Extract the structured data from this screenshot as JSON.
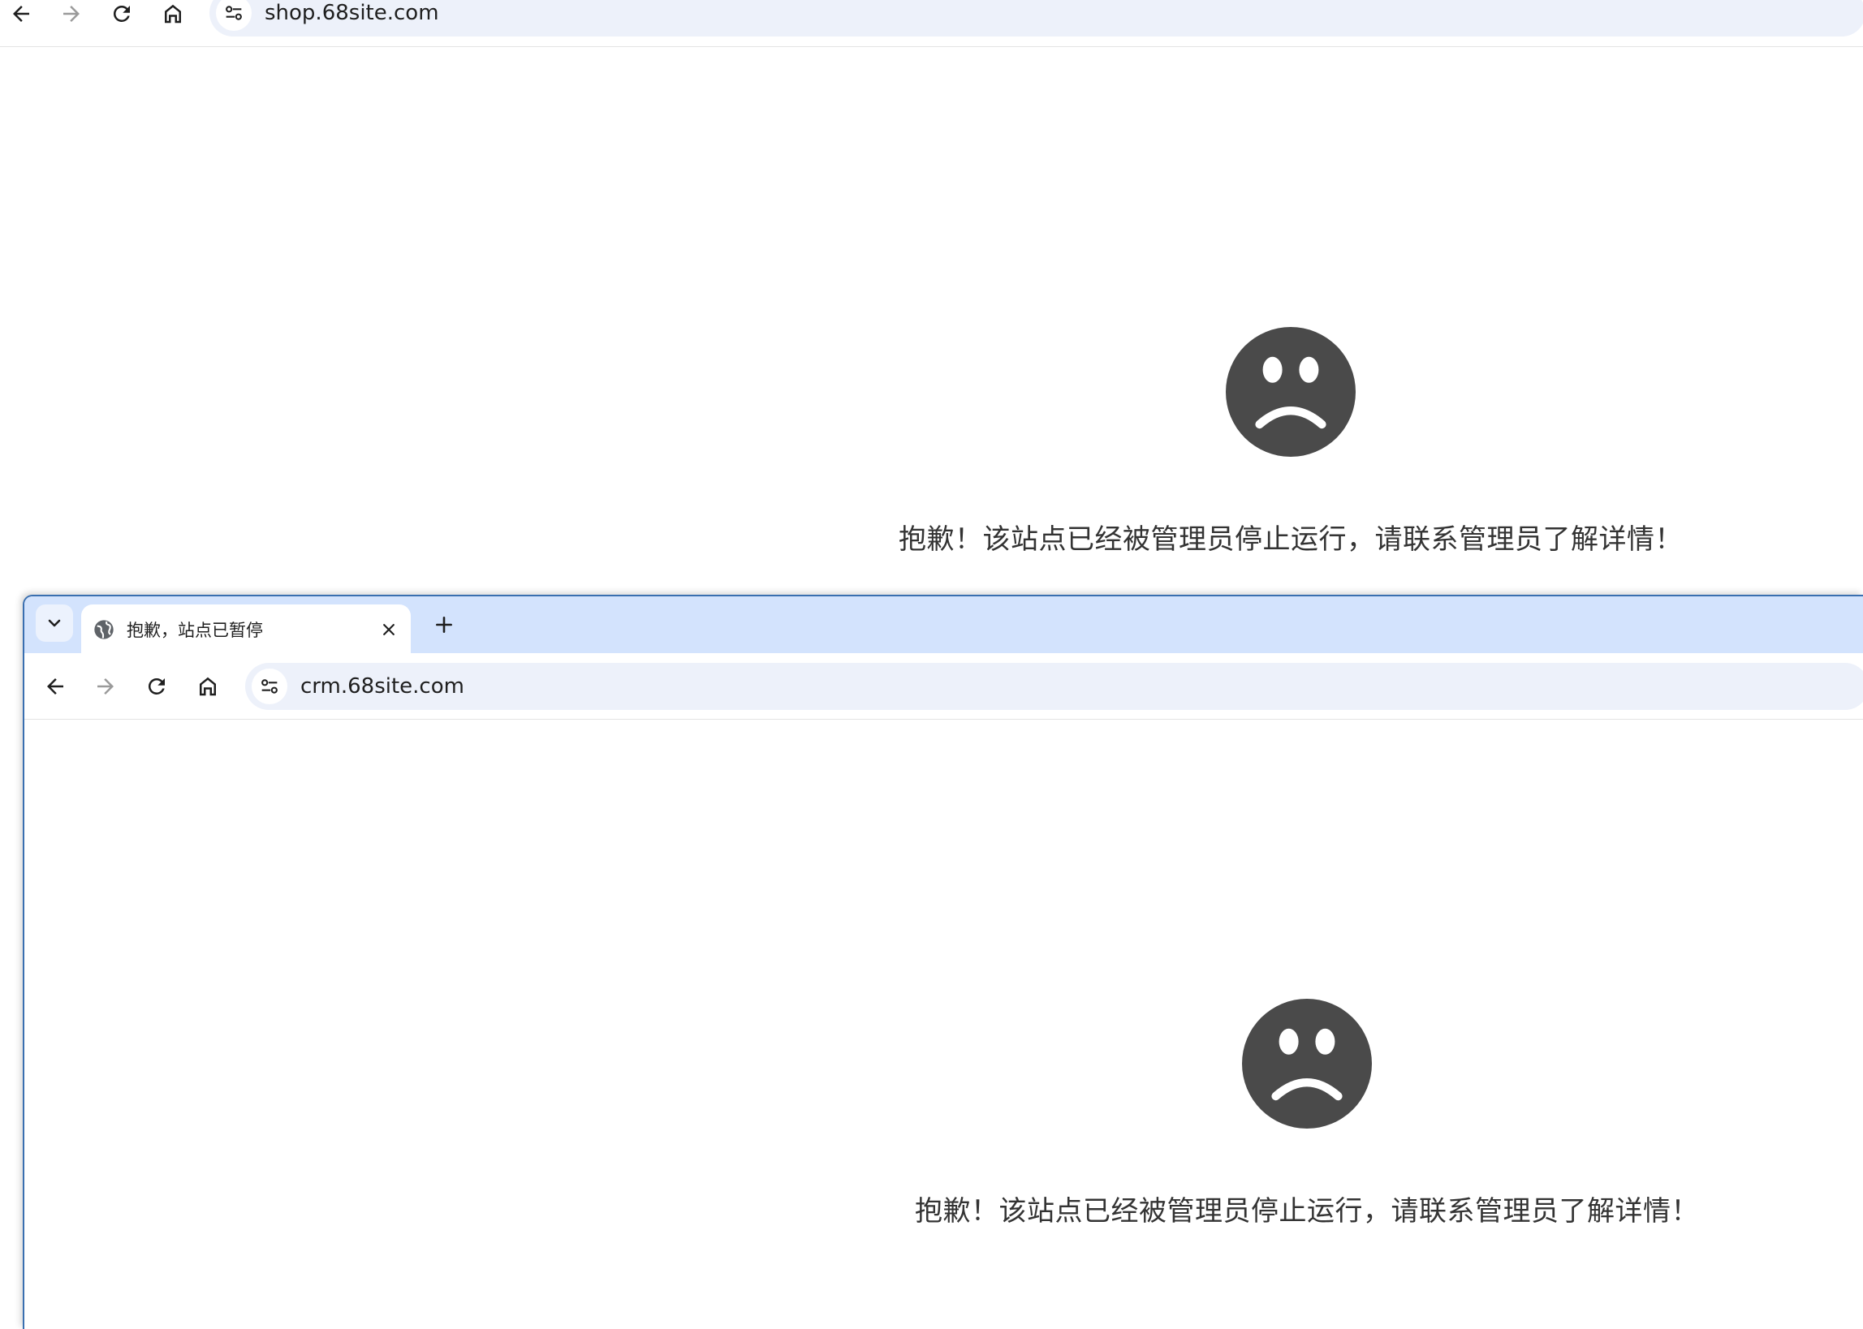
{
  "back_window": {
    "url": "shop.68site.com",
    "error_message": "抱歉！该站点已经被管理员停止运行，请联系管理员了解详情！"
  },
  "front_window": {
    "tab_title": "抱歉，站点已暂停",
    "url": "crm.68site.com",
    "error_message": "抱歉！该站点已经被管理员停止运行，请联系管理员了解详情！"
  },
  "icons": {
    "back": "arrow-left-icon",
    "forward": "arrow-right-icon",
    "reload": "reload-icon",
    "home": "home-icon",
    "site_info": "tune-icon",
    "tab_search": "chevron-down-icon",
    "favicon": "globe-icon",
    "close": "close-icon",
    "new_tab": "plus-icon",
    "error": "sad-face-icon"
  },
  "colors": {
    "tab_strip": "#d3e3fd",
    "omnibox": "#edf1fa",
    "sad_face": "#4a4a4a",
    "window_border": "#3a6fb0"
  }
}
